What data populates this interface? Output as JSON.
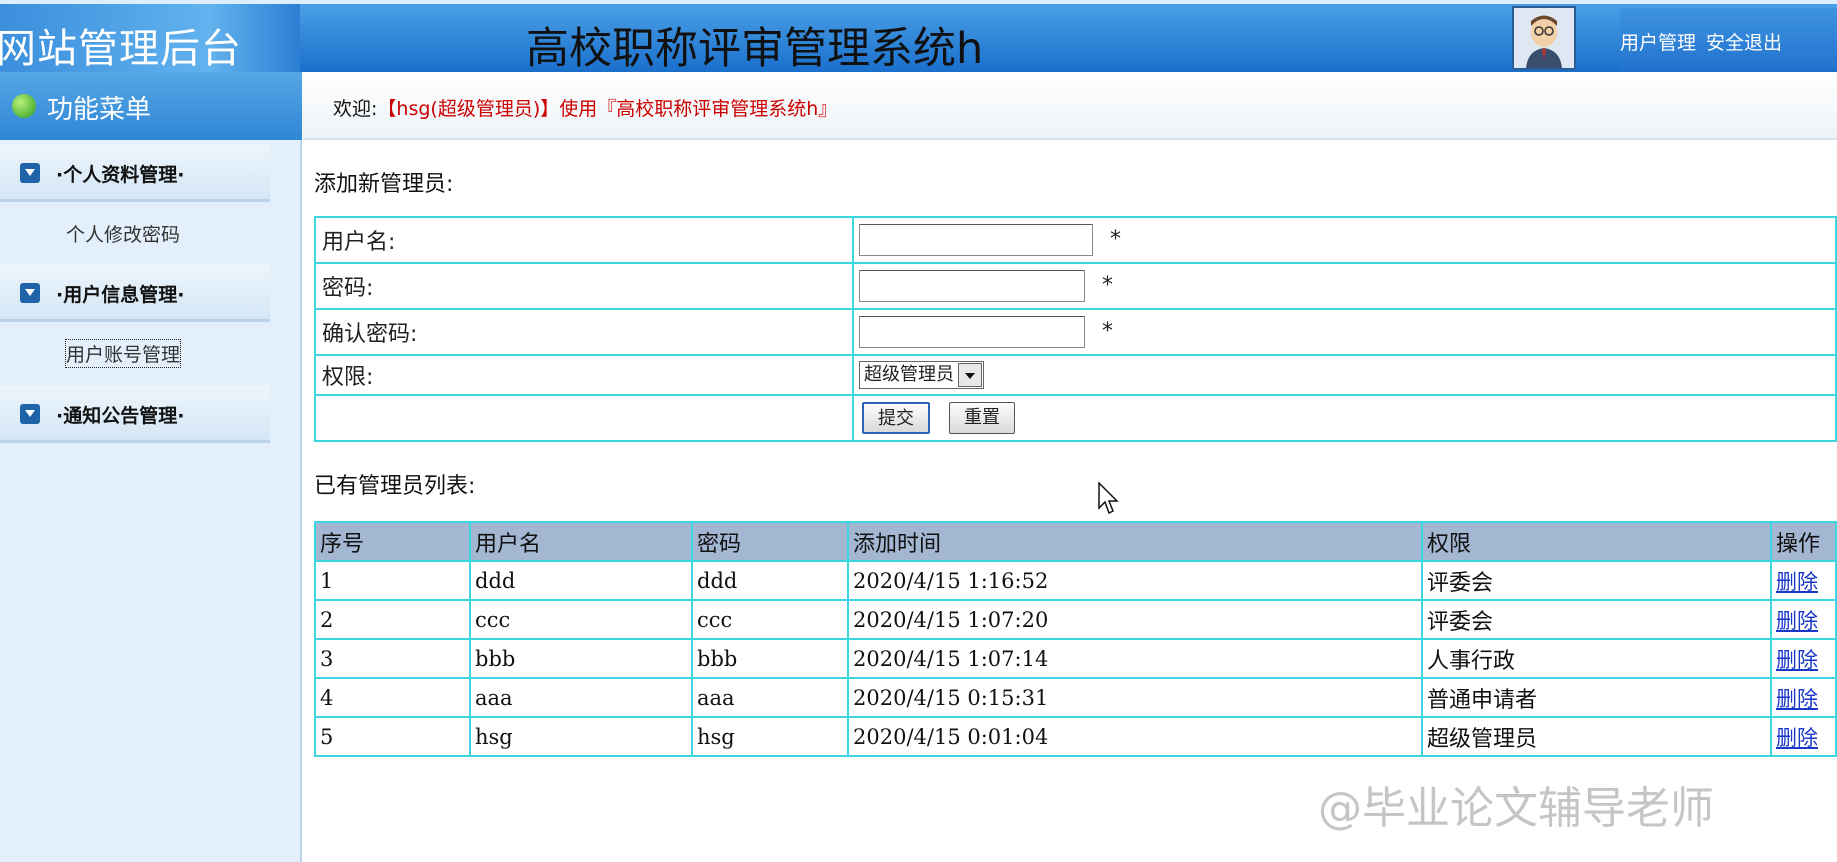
{
  "header": {
    "logo_text": "网站管理后台",
    "system_title": "高校职称评审管理系统h",
    "links": [
      "用户管理",
      "安全退出"
    ]
  },
  "sidebar": {
    "title": "功能菜单",
    "groups": [
      {
        "label": "·个人资料管理·",
        "items": [
          "个人修改密码"
        ]
      },
      {
        "label": "·用户信息管理·",
        "items": [
          "用户账号管理"
        ]
      },
      {
        "label": "·通知公告管理·",
        "items": []
      }
    ]
  },
  "welcome": {
    "lead": "欢迎:",
    "user": "【hsg(超级管理员)】使用『高校职称评审管理系统h』"
  },
  "form": {
    "title": "添加新管理员:",
    "username_label": "用户名:",
    "password_label": "密码:",
    "confirm_label": "确认密码:",
    "role_label": "权限:",
    "required_mark": "*",
    "role_selected": "超级管理员",
    "submit_label": "提交",
    "reset_label": "重置"
  },
  "list": {
    "title": "已有管理员列表:",
    "columns": [
      "序号",
      "用户名",
      "密码",
      "添加时间",
      "权限",
      "操作"
    ],
    "rows": [
      {
        "id": "1",
        "username": "ddd",
        "password": "ddd",
        "time": "2020/4/15 1:16:52",
        "role": "评委会",
        "action": "删除"
      },
      {
        "id": "2",
        "username": "ccc",
        "password": "ccc",
        "time": "2020/4/15 1:07:20",
        "role": "评委会",
        "action": "删除"
      },
      {
        "id": "3",
        "username": "bbb",
        "password": "bbb",
        "time": "2020/4/15 1:07:14",
        "role": "人事行政",
        "action": "删除"
      },
      {
        "id": "4",
        "username": "aaa",
        "password": "aaa",
        "time": "2020/4/15 0:15:31",
        "role": "普通申请者",
        "action": "删除"
      },
      {
        "id": "5",
        "username": "hsg",
        "password": "hsg",
        "time": "2020/4/15 0:01:04",
        "role": "超级管理员",
        "action": "删除"
      }
    ]
  },
  "watermark": "@毕业论文辅导老师",
  "colors": {
    "header_blue": "#1a6fcc",
    "table_border": "#3cd6e0",
    "table_header_bg": "#a3b6d2",
    "welcome_red": "#cc0000",
    "link_blue": "#1a38c8"
  }
}
